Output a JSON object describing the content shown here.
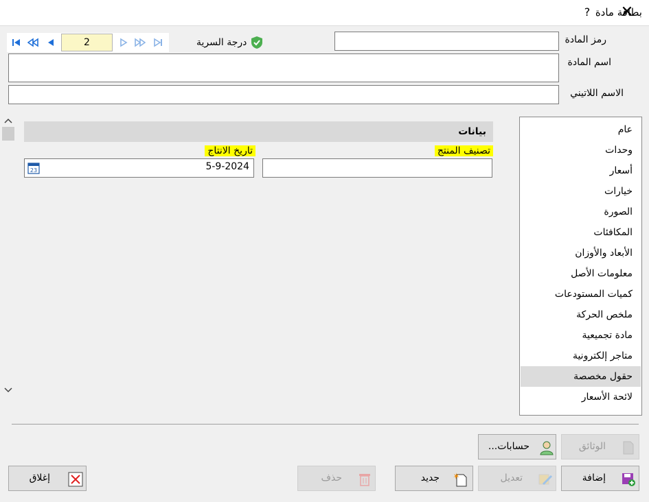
{
  "window": {
    "title": "بطاقة مادة",
    "help": "?",
    "close": "✕"
  },
  "navigation": {
    "current_page": "2"
  },
  "security": {
    "label": "درجة السرية"
  },
  "fields": {
    "code_label": "رمز المادة",
    "code_value": "",
    "name_label": "اسم المادة",
    "name_value": "",
    "latin_label": "الاسم اللاتيني",
    "latin_value": ""
  },
  "section": {
    "title": "بيانات",
    "product_class_label": "تصنيف المنتج",
    "product_class_value": "",
    "production_date_label": "تاريخ الانتاج",
    "production_date_value": "5-9-2024"
  },
  "sidebar": {
    "items": [
      {
        "label": "عام"
      },
      {
        "label": "وحدات"
      },
      {
        "label": "أسعار"
      },
      {
        "label": "خيارات"
      },
      {
        "label": "الصورة"
      },
      {
        "label": "المكافئات"
      },
      {
        "label": "الأبعاد والأوزان"
      },
      {
        "label": "معلومات الأصل"
      },
      {
        "label": "كميات المستودعات"
      },
      {
        "label": "ملخص الحركة"
      },
      {
        "label": "مادة تجميعية"
      },
      {
        "label": "متاجر إلكترونية"
      },
      {
        "label": "حقول مخصصة"
      },
      {
        "label": "لائحة الأسعار"
      }
    ],
    "active_index": 12
  },
  "buttons": {
    "documents": "الوثائق",
    "accounts": "حسابات...",
    "add": "إضافة",
    "edit": "تعديل",
    "new": "جديد",
    "delete": "حذف",
    "close": "إغلاق"
  },
  "colors": {
    "highlight": "#ffff00",
    "page_input_bg": "#fbf7c6",
    "nav_blue": "#1e6fd9"
  }
}
